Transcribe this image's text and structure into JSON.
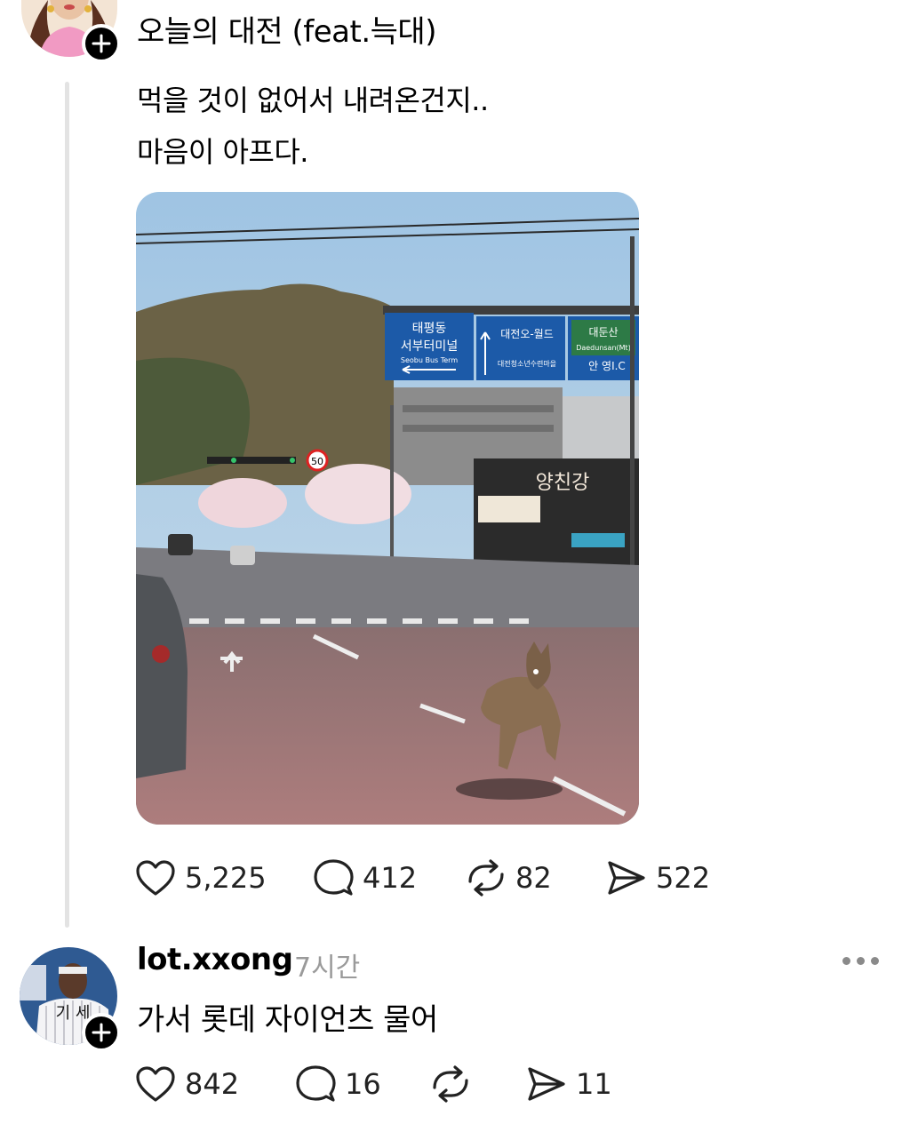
{
  "post": {
    "title": "오늘의 대전 (feat.늑대)",
    "body_line1": "먹을 것이 없어서 내려온건지..",
    "body_line2": "마음이 아프다.",
    "image": {
      "signs": {
        "sign1_line1": "태평동",
        "sign1_line2": "서부터미널",
        "sign1_line3": "Seobu Bus Term",
        "sign2_line1": "대전오-월드",
        "sign2_line2": "대전청소년수련마을",
        "sign3_line1": "대둔산",
        "sign3_line2": "Daedunsan(Mt)",
        "sign3_line3": "안 영I.C",
        "speed": "50",
        "shop": "양친강"
      }
    },
    "actions": {
      "likes": "5,225",
      "comments": "412",
      "reposts": "82",
      "shares": "522"
    }
  },
  "reply": {
    "username": "lot.xxong",
    "time": "7시간",
    "text": "가서 롯데 자이언츠 물어",
    "jersey_text": "기 세",
    "actions": {
      "likes": "842",
      "comments": "16",
      "reposts": "",
      "shares": "11"
    }
  },
  "colors": {
    "accent": "#000000",
    "muted": "#9a9a9a",
    "thread_line": "#e3e3e3"
  },
  "icons": [
    "follow-plus-icon",
    "heart-icon",
    "comment-icon",
    "repost-icon",
    "share-icon",
    "more-icon"
  ]
}
